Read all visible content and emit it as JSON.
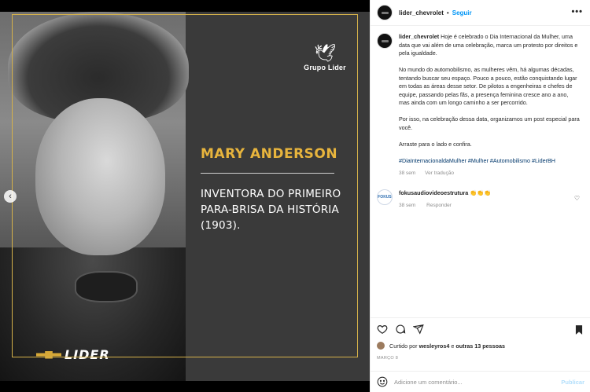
{
  "post_image": {
    "brand": "Grupo Lider",
    "name": "MARY ANDERSON",
    "description": "INVENTORA DO PRIMEIRO\nPARA-BRISA DA HISTÓRIA\n(1903).",
    "footer_logo": "LIDER",
    "carousel": {
      "total": 4,
      "active_index": 3
    },
    "colors": {
      "accent": "#e7b43d",
      "frame": "#d6b24a"
    }
  },
  "header": {
    "username": "lider_chevrolet",
    "separator": "•",
    "follow_label": "Seguir",
    "more_label": "•••"
  },
  "caption": {
    "username": "lider_chevrolet",
    "paragraphs": [
      "Hoje é celebrado o Dia Internacional da Mulher, uma data que vai além de uma celebração, marca um protesto por direitos e pela igualdade.",
      "No mundo do automobilismo, as mulheres vêm, há algumas décadas, tentando buscar seu espaço. Pouco a pouco, estão conquistando lugar em todas as áreas desse setor. De pilotos a engenheiras e chefes de equipe, passando pelas fãs, a presença feminina cresce ano a ano, mas ainda com um longo caminho a ser percorrido.",
      "Por isso, na celebração dessa data, organizamos um post especial para você.",
      "Arraste para o lado e confira."
    ],
    "hashtags": "#DiaInternacionaldaMulher #Mulher #Automobilismo #LiderBH",
    "time": "38 sem",
    "translate": "Ver tradução"
  },
  "comment": {
    "avatar_text": "FOKUS",
    "username": "fokusaudiovideoestrutura",
    "text": "👏👏👏",
    "time": "38 sem",
    "reply": "Responder",
    "heart": "♡"
  },
  "likes": {
    "prefix": "Curtido por",
    "user": "wesleyros4",
    "middle": "e",
    "others": "outras 13 pessoas"
  },
  "date": "MARÇO 8",
  "add_comment": {
    "placeholder": "Adicione um comentário...",
    "publish_label": "Publicar"
  }
}
